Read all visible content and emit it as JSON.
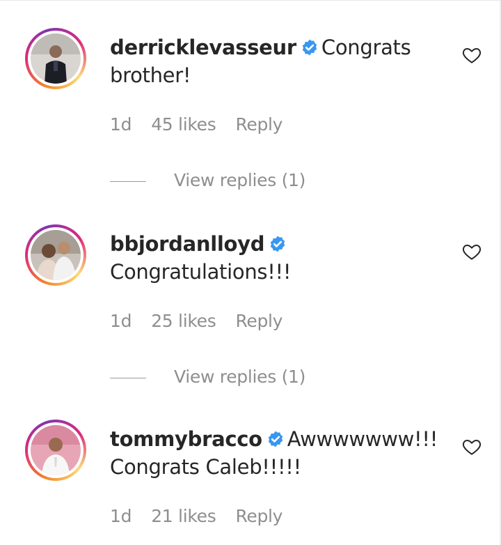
{
  "comments": [
    {
      "username": "derricklevasseur",
      "text_line1": "Congrats",
      "text_line2": "brother!",
      "time": "1d",
      "likes": "45 likes",
      "reply": "Reply",
      "view_replies": "View replies (1)"
    },
    {
      "username": "bbjordanlloyd",
      "text_line1": "",
      "text_line2": "Congratulations!!!",
      "time": "1d",
      "likes": "25 likes",
      "reply": "Reply",
      "view_replies": "View replies (1)"
    },
    {
      "username": "tommybracco",
      "text_line1": "Awwwwwww!!!",
      "text_line2": "Congrats Caleb!!!!!",
      "time": "1d",
      "likes": "21 likes",
      "reply": "Reply"
    }
  ],
  "colors": {
    "text": "#262626",
    "muted": "#8e8e8e",
    "verified_blue": "#3897f0"
  },
  "icons": {
    "verified": "verified-badge-icon",
    "like": "heart-outline-icon"
  }
}
